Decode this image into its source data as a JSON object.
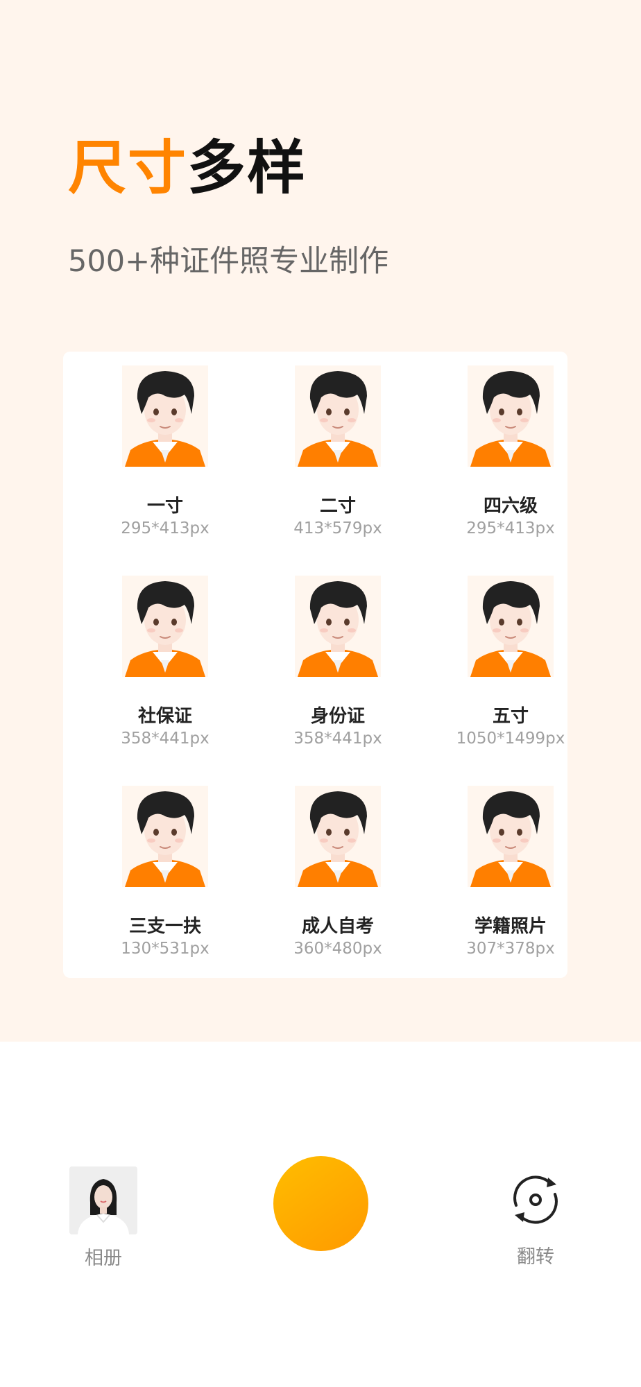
{
  "header": {
    "title_accent": "尺寸",
    "title_rest": "多样",
    "subtitle": "500+种证件照专业制作"
  },
  "sizes": [
    {
      "name": "一寸",
      "size": "295*413px"
    },
    {
      "name": "二寸",
      "size": "413*579px"
    },
    {
      "name": "四六级",
      "size": "295*413px"
    },
    {
      "name": "社保证",
      "size": "358*441px"
    },
    {
      "name": "身份证",
      "size": "358*441px"
    },
    {
      "name": "五寸",
      "size": "1050*1499px"
    },
    {
      "name": "三支一扶",
      "size": "130*531px"
    },
    {
      "name": "成人自考",
      "size": "360*480px"
    },
    {
      "name": "学籍照片",
      "size": "307*378px"
    }
  ],
  "bottom": {
    "album_label": "相册",
    "flip_label": "翻转"
  },
  "colors": {
    "accent": "#ff8400",
    "background": "#fff5ed",
    "shutter": "#ffa800",
    "shirt": "#ff7f00"
  },
  "icons": {
    "shutter": "shutter-button",
    "flip": "rotate-camera-icon",
    "album": "photo-thumbnail"
  }
}
